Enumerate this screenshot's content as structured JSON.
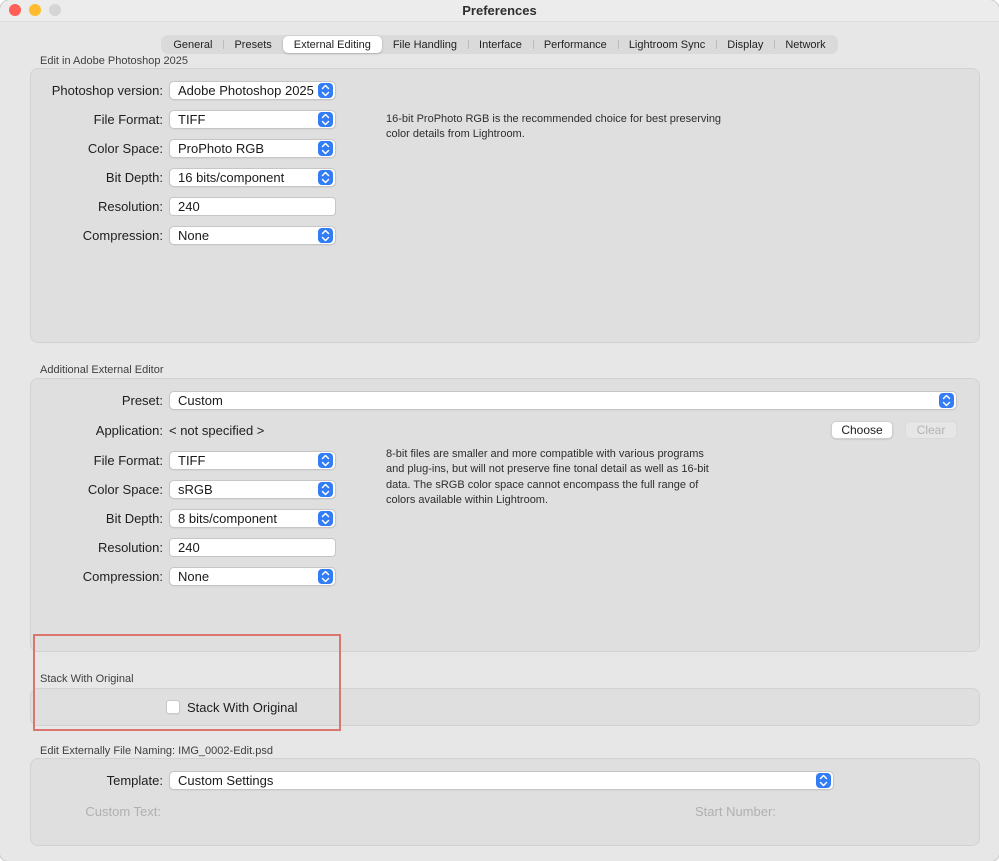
{
  "colors": {
    "accent_blue": "#327cf6",
    "annotation_red": "#d9766d",
    "traffic_red": "#ff5f57",
    "traffic_yellow": "#febc2e",
    "traffic_gray": "#d5d5d5"
  },
  "window": {
    "title": "Preferences"
  },
  "tabs": [
    {
      "label": "General",
      "active": false
    },
    {
      "label": "Presets",
      "active": false
    },
    {
      "label": "External Editing",
      "active": true
    },
    {
      "label": "File Handling",
      "active": false
    },
    {
      "label": "Interface",
      "active": false
    },
    {
      "label": "Performance",
      "active": false
    },
    {
      "label": "Lightroom Sync",
      "active": false
    },
    {
      "label": "Display",
      "active": false
    },
    {
      "label": "Network",
      "active": false
    }
  ],
  "photoshop_section": {
    "label": "Edit in Adobe Photoshop 2025",
    "photoshop_version_label": "Photoshop version:",
    "photoshop_version_value": "Adobe Photoshop 2025",
    "file_format_label": "File Format:",
    "file_format_value": "TIFF",
    "color_space_label": "Color Space:",
    "color_space_value": "ProPhoto RGB",
    "bit_depth_label": "Bit Depth:",
    "bit_depth_value": "16 bits/component",
    "resolution_label": "Resolution:",
    "resolution_value": "240",
    "compression_label": "Compression:",
    "compression_value": "None",
    "help": "16-bit ProPhoto RGB is the recommended choice for best preserving\ncolor details from Lightroom."
  },
  "additional_section": {
    "label": "Additional External Editor",
    "preset_label": "Preset:",
    "preset_value": "Custom",
    "application_label": "Application:",
    "application_value": "< not specified >",
    "choose_button": "Choose",
    "clear_button": "Clear",
    "file_format_label": "File Format:",
    "file_format_value": "TIFF",
    "color_space_label": "Color Space:",
    "color_space_value": "sRGB",
    "bit_depth_label": "Bit Depth:",
    "bit_depth_value": "8 bits/component",
    "resolution_label": "Resolution:",
    "resolution_value": "240",
    "compression_label": "Compression:",
    "compression_value": "None",
    "help": "8-bit files are smaller and more compatible with various programs\nand plug-ins, but will not preserve fine tonal detail as well as 16-bit\ndata. The sRGB color space cannot encompass the full range of\ncolors available within Lightroom."
  },
  "stack_section": {
    "label": "Stack With Original",
    "checkbox_label": "Stack With Original",
    "checked": false
  },
  "naming_section": {
    "label": "Edit Externally File Naming:  IMG_0002-Edit.psd",
    "template_label": "Template:",
    "template_value": "Custom Settings",
    "custom_text_label": "Custom Text:",
    "start_number_label": "Start Number:"
  }
}
